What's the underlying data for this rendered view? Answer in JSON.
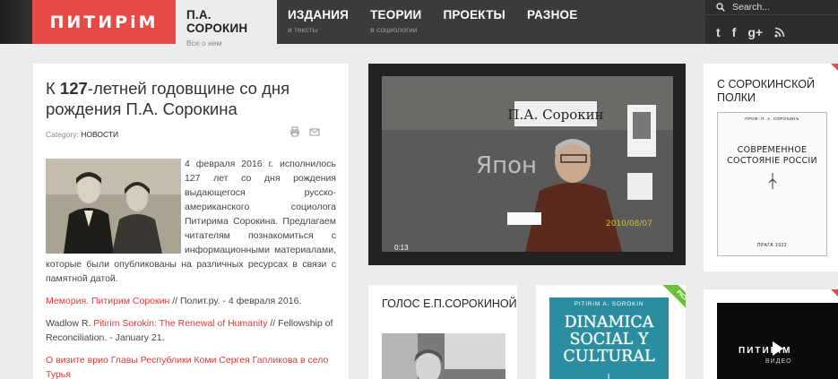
{
  "header": {
    "logo_text": "ПИТИРiМ",
    "nav": [
      {
        "title": "П.А. СОРОКИН",
        "sub": "Все о нем"
      },
      {
        "title": "ИЗДАНИЯ",
        "sub": "и тексты"
      },
      {
        "title": "ТЕОРИИ",
        "sub": "в социологии"
      },
      {
        "title": "ПРОЕКТЫ",
        "sub": ""
      },
      {
        "title": "РАЗНОЕ",
        "sub": ""
      }
    ],
    "search_placeholder": "Search...",
    "social": [
      "twitter-icon",
      "facebook-icon",
      "google-plus-icon",
      "rss-icon"
    ],
    "social_glyphs": [
      "t",
      "f",
      "g+",
      "rss"
    ]
  },
  "article": {
    "title_prefix": "К ",
    "title_bold": "127",
    "title_rest": "-летней годовщине со дня рождения П.А. Сорокина",
    "category_label": "Category:",
    "category_value": "НОВОСТИ",
    "intro": "4 февраля 2016 г. исполнилось 127 лет со дня рождения выдающегося русско-американского социолога Питирима Сорокина. Предлагаем читателям познакомиться с информационными материалами, которые были опубликованы на различных ресурсах в связи с памятной датой.",
    "link1_red": "Мемория. Питирим Сорокин",
    "link1_tail": " // Полит.ру. - 4 февраля 2016.",
    "link2_head": "Wadlow R. ",
    "link2_red": "Pitirim Sorokin: The Renewal of Humanity",
    "link2_tail": " // Fellowship of Reconciliation. - January 21.",
    "link3_red": "О визите врио Главы Республики Коми Сергея Гапликова в село Турья"
  },
  "video": {
    "board_label": "П.А. Сорокин",
    "chalk": "Япон",
    "date_stamp": "2010/08/07",
    "time": "0:13"
  },
  "sidebar": {
    "shelf_title": "С СОРОКИНСКОЙ ПОЛКИ",
    "book_author": "ПРОФ. П. А. СОРОКИНЪ",
    "book_title": "СОВРЕМЕННОЕ СОСТОЯНІЕ РОССІИ",
    "book_place": "ПРАГА 1922",
    "video_logo": "ПИТИРiМ",
    "video_sub": "ВИДЕО"
  },
  "voice": {
    "title": "ГОЛОС Е.П.СОРОКИНОЙ"
  },
  "book2": {
    "author": "PITIRIM A. SOROKIN",
    "title": "DINAMICA SOCIAL Y CULTURAL",
    "volume": "I",
    "badge": "PICK"
  },
  "colors": {
    "brand": "#e84a47",
    "header_bg": "#3b3b3b",
    "link_red": "#e23a36",
    "badge_green": "#6fbf3b"
  }
}
